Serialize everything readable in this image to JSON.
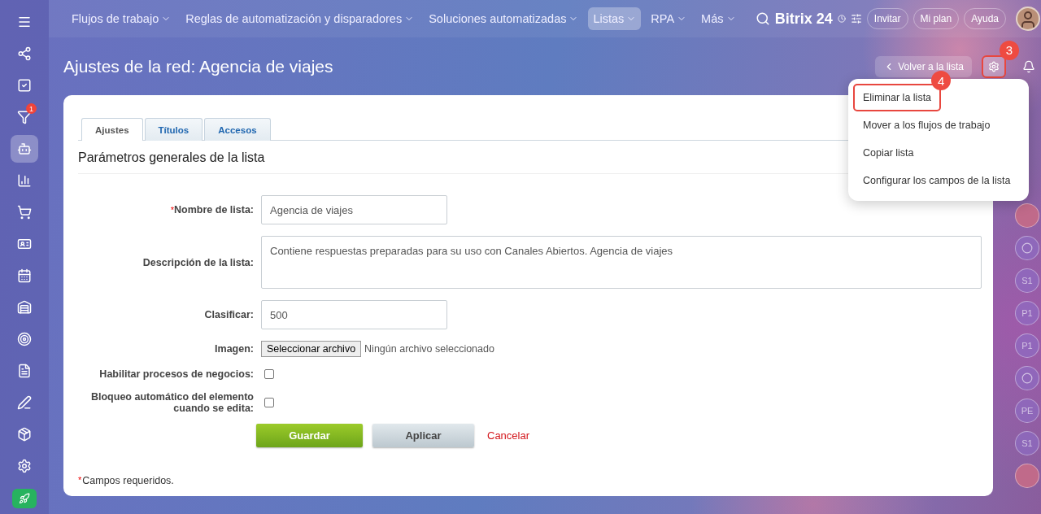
{
  "topbar": {
    "nav": [
      {
        "label": "Flujos de trabajo",
        "selected": false
      },
      {
        "label": "Reglas de automatización y disparadores",
        "selected": false
      },
      {
        "label": "Soluciones automatizadas",
        "selected": false
      },
      {
        "label": "Listas",
        "selected": true
      },
      {
        "label": "RPA",
        "selected": false
      },
      {
        "label": "Más",
        "selected": false
      }
    ],
    "logo": "Bitrix 24",
    "buttons": [
      "Invitar",
      "Mi plan",
      "Ayuda"
    ]
  },
  "sidebar": {
    "items": [
      {
        "kind": "share",
        "selected": false
      },
      {
        "kind": "tasks",
        "selected": false
      },
      {
        "kind": "funnel",
        "selected": false,
        "counter": "1"
      },
      {
        "kind": "robot",
        "selected": true
      },
      {
        "kind": "chart",
        "selected": false
      },
      {
        "kind": "cart",
        "selected": false
      },
      {
        "kind": "cards",
        "selected": false
      },
      {
        "kind": "calendar",
        "selected": false
      },
      {
        "kind": "warehouse",
        "selected": false
      },
      {
        "kind": "target",
        "selected": false
      },
      {
        "kind": "document",
        "selected": false
      },
      {
        "kind": "sign",
        "selected": false
      },
      {
        "kind": "box",
        "selected": false
      },
      {
        "kind": "settings",
        "selected": false
      }
    ]
  },
  "page": {
    "title": "Ajustes de la red: Agencia de viajes",
    "back_button": "Volver a la lista",
    "settings_callout": "3"
  },
  "menu": {
    "items": [
      {
        "label": "Eliminar la lista",
        "highlighted": true,
        "callout": "4"
      },
      {
        "label": "Mover a los flujos de trabajo",
        "highlighted": false
      },
      {
        "label": "Copiar lista",
        "highlighted": false
      },
      {
        "label": "Configurar los campos de la lista",
        "highlighted": false
      }
    ]
  },
  "tabs": [
    {
      "label": "Ajustes",
      "selected": true
    },
    {
      "label": "Títulos",
      "selected": false
    },
    {
      "label": "Accesos",
      "selected": false
    }
  ],
  "section_title": "Parámetros generales de la lista",
  "fields": [
    {
      "kind": "text",
      "mark": "*",
      "label": "Nombre de lista:",
      "value": "Agencia de viajes"
    },
    {
      "kind": "textarea",
      "label": "Descripción de la lista:",
      "value": "Contiene respuestas preparadas para su uso con Canales Abiertos. Agencia de viajes"
    },
    {
      "kind": "text",
      "label": "Clasificar:",
      "value": "500"
    },
    {
      "kind": "file",
      "label": "Imagen:",
      "button": "Seleccionar archivo",
      "status": "Ningún archivo seleccionado"
    },
    {
      "kind": "checkbox",
      "label": "Habilitar procesos de negocios:",
      "checked": false
    },
    {
      "kind": "checkbox",
      "label": "Bloqueo automático del elemento cuando se edita:",
      "checked": false
    }
  ],
  "actions": {
    "save": "Guardar",
    "apply": "Aplicar",
    "cancel": "Cancelar"
  },
  "footnote": {
    "mark": "*",
    "text": "Campos requeridos."
  },
  "right_rail": [
    {
      "kind": "picture"
    },
    {
      "kind": "icon"
    },
    {
      "kind": "initials",
      "text": "S1"
    },
    {
      "kind": "initials",
      "text": "P1"
    },
    {
      "kind": "initials",
      "text": "P1"
    },
    {
      "kind": "icon"
    },
    {
      "kind": "initials",
      "text": "PE"
    },
    {
      "kind": "initials",
      "text": "S1"
    },
    {
      "kind": "picture"
    }
  ]
}
